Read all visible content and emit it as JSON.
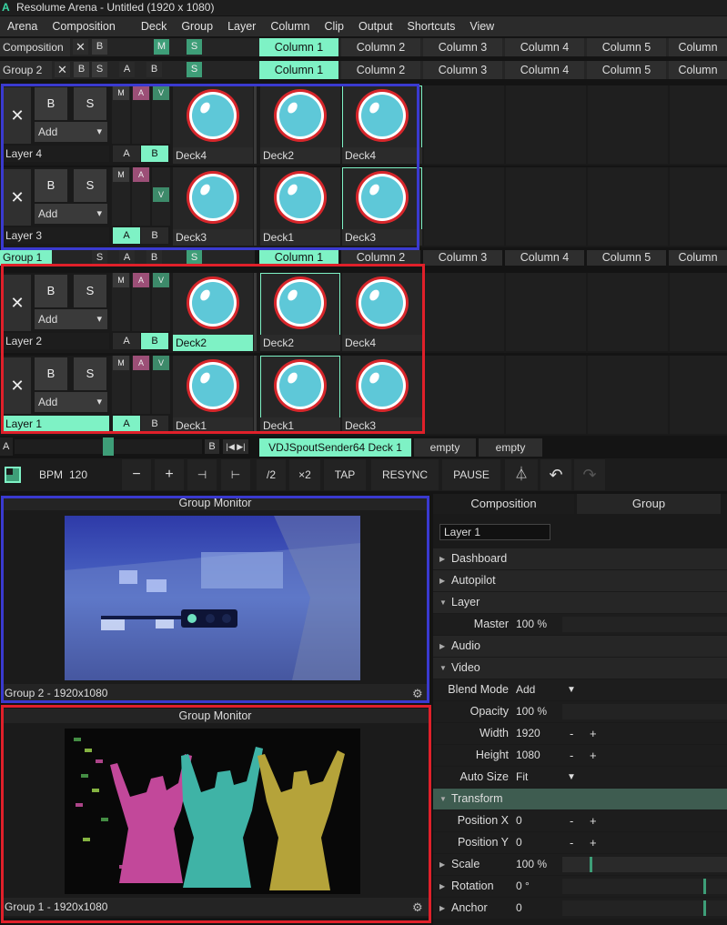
{
  "titlebar": {
    "title": "Resolume Arena - Untitled (1920 x 1080)"
  },
  "menu": [
    "Arena",
    "Composition",
    "Deck",
    "Group",
    "Layer",
    "Column",
    "Clip",
    "Output",
    "Shortcuts",
    "View"
  ],
  "rows": {
    "composition": {
      "label": "Composition",
      "b": "B",
      "m": "M",
      "s": "S"
    },
    "group2": {
      "label": "Group 2",
      "b": "B",
      "s": "S",
      "a": "A",
      "bb": "B",
      "s2": "S"
    },
    "group1": {
      "label": "Group 1",
      "s": "S",
      "a": "A",
      "b": "B",
      "s2": "S"
    }
  },
  "columns": [
    "Column 1",
    "Column 2",
    "Column 3",
    "Column 4",
    "Column 5",
    "Column"
  ],
  "layers": [
    {
      "name": "Layer 4",
      "clips": [
        "Deck4",
        "Deck2",
        "Deck4"
      ],
      "b": "B",
      "s": "S",
      "add": "Add",
      "m": "M",
      "a": "A",
      "v": "V",
      "ab_a": "A",
      "ab_b": "B"
    },
    {
      "name": "Layer 3",
      "clips": [
        "Deck3",
        "Deck1",
        "Deck3"
      ],
      "b": "B",
      "s": "S",
      "add": "Add",
      "m": "M",
      "a": "A",
      "v": "V",
      "ab_a": "A",
      "ab_b": "B"
    },
    {
      "name": "Layer 2",
      "clips": [
        "Deck2",
        "Deck2",
        "Deck4"
      ],
      "b": "B",
      "s": "S",
      "add": "Add",
      "m": "M",
      "a": "A",
      "v": "V",
      "ab_a": "A",
      "ab_b": "B"
    },
    {
      "name": "Layer 1",
      "clips": [
        "Deck1",
        "Deck1",
        "Deck3"
      ],
      "b": "B",
      "s": "S",
      "add": "Add",
      "m": "M",
      "a": "A",
      "v": "V",
      "ab_a": "A",
      "ab_b": "B"
    }
  ],
  "decks": {
    "a": "A",
    "b": "B",
    "active": "VDJSpoutSender64 Deck 1",
    "empty1": "empty",
    "empty2": "empty"
  },
  "transport": {
    "bpm_label": "BPM",
    "bpm": "120",
    "minus": "−",
    "plus": "+",
    "half": "/2",
    "double": "×2",
    "tap": "TAP",
    "resync": "RESYNC",
    "pause": "PAUSE"
  },
  "monitors": [
    {
      "title": "Group Monitor",
      "footer": "Group 2 - 1920x1080"
    },
    {
      "title": "Group Monitor",
      "footer": "Group 1 - 1920x1080"
    }
  ],
  "props": {
    "tabs": [
      "Composition",
      "Group"
    ],
    "layer_name": "Layer 1",
    "sections": {
      "dashboard": "Dashboard",
      "autopilot": "Autopilot",
      "layer": "Layer",
      "audio": "Audio",
      "video": "Video",
      "transform": "Transform",
      "scale": "Scale",
      "rotation": "Rotation",
      "anchor": "Anchor"
    },
    "master": {
      "label": "Master",
      "value": "100 %"
    },
    "blend": {
      "label": "Blend Mode",
      "value": "Add"
    },
    "opacity": {
      "label": "Opacity",
      "value": "100 %"
    },
    "width": {
      "label": "Width",
      "value": "1920"
    },
    "height": {
      "label": "Height",
      "value": "1080"
    },
    "autosize": {
      "label": "Auto Size",
      "value": "Fit"
    },
    "posx": {
      "label": "Position X",
      "value": "0"
    },
    "posy": {
      "label": "Position Y",
      "value": "0"
    },
    "scale_val": "100 %",
    "rotation_val": "0 °",
    "anchor_val": "0",
    "minus": "-",
    "plus": "+"
  },
  "colors": {
    "accent": "#7ef2c5",
    "blue_outline": "#3a3ad0",
    "red_outline": "#e0202a"
  }
}
